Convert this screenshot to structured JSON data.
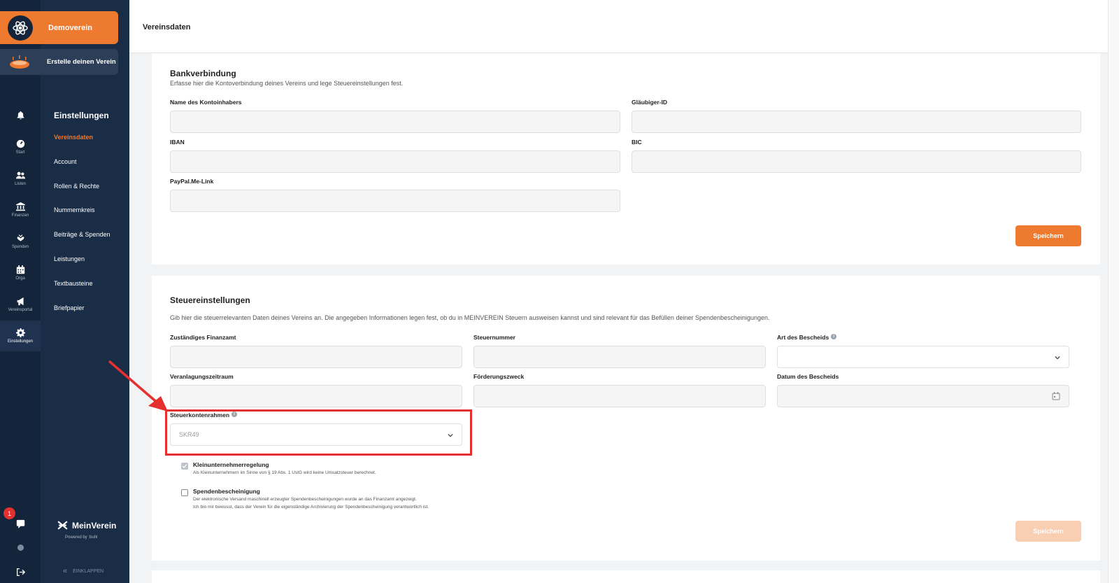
{
  "header": {
    "title": "Vereinsdaten"
  },
  "brand": {
    "name": "Demoverein",
    "create_label": "Erstelle deinen Verein"
  },
  "rail": {
    "items": [
      {
        "label": "",
        "icon": "bell-icon"
      },
      {
        "label": "Start",
        "icon": "dashboard-icon"
      },
      {
        "label": "Listen",
        "icon": "users-icon"
      },
      {
        "label": "Finanzen",
        "icon": "bank-icon"
      },
      {
        "label": "Spenden",
        "icon": "heart-hand-icon"
      },
      {
        "label": "Orga",
        "icon": "calendar-icon"
      },
      {
        "label": "Vereinsportal",
        "icon": "megaphone-icon"
      },
      {
        "label": "Einstellungen",
        "icon": "gear-icon"
      }
    ],
    "notification_count": "1"
  },
  "menu": {
    "title": "Einstellungen",
    "items": [
      {
        "label": "Vereinsdaten",
        "active": true
      },
      {
        "label": "Account"
      },
      {
        "label": "Rollen & Rechte"
      },
      {
        "label": "Nummernkreis"
      },
      {
        "label": "Beiträge & Spenden"
      },
      {
        "label": "Leistungen"
      },
      {
        "label": "Textbausteine"
      },
      {
        "label": "Briefpapier"
      }
    ],
    "logo_text": "MeinVerein",
    "powered_by": "Powered by :buhl",
    "collapse_label": "EINKLAPPEN"
  },
  "bank": {
    "title": "Bankverbindung",
    "subtitle": "Erfasse hier die Kontoverbindung deines Vereins und lege Steuereinstellungen fest.",
    "fields": {
      "holder": {
        "label": "Name des Kontoinhabers",
        "value": ""
      },
      "creditor": {
        "label": "Gläubiger-ID",
        "value": ""
      },
      "iban": {
        "label": "IBAN",
        "value": ""
      },
      "bic": {
        "label": "BIC",
        "value": ""
      },
      "paypal": {
        "label": "PayPal.Me-Link",
        "value": ""
      }
    },
    "save_label": "Speichern"
  },
  "tax": {
    "title": "Steuereinstellungen",
    "subtitle": "Gib hier die steuerrelevanten Daten deines Vereins an. Die angegeben Informationen legen fest, ob du in MEINVEREIN Steuern ausweisen kannst und sind relevant für das Befüllen deiner Spendenbescheinigungen.",
    "fields": {
      "office": {
        "label": "Zuständiges Finanzamt",
        "value": ""
      },
      "taxnumber": {
        "label": "Steuernummer",
        "value": ""
      },
      "notice_type": {
        "label": "Art des Bescheids",
        "value": ""
      },
      "period": {
        "label": "Veranlagungszeitraum",
        "value": ""
      },
      "purpose": {
        "label": "Förderungszweck",
        "value": ""
      },
      "notice_date": {
        "label": "Datum des Bescheids",
        "value": ""
      },
      "chart": {
        "label": "Steuerkontenrahmen",
        "value": "SKR49"
      }
    },
    "small_business": {
      "title": "Kleinunternehmerregelung",
      "desc": "Als Kleinunternehmern im Sinne von § 19 Abs. 1 UstG wird keine Umsatzsteuer berechnet.",
      "checked": true
    },
    "donation": {
      "title": "Spendenbescheinigung",
      "desc1": "Der elektronische Versand maschinell erzeugter Spendenbescheinigungen wurde an das Finanzamt angezeigt.",
      "desc2": "Ich bin mir bewusst, dass der Verein für die eigenständige Archivierung der Spendenbescheinigung verantwortlich ist.",
      "checked": false
    },
    "save_label": "Speichern"
  },
  "colors": {
    "accent": "#ee7a2f",
    "sidebar": "#14243a",
    "highlight": "#e53030"
  }
}
